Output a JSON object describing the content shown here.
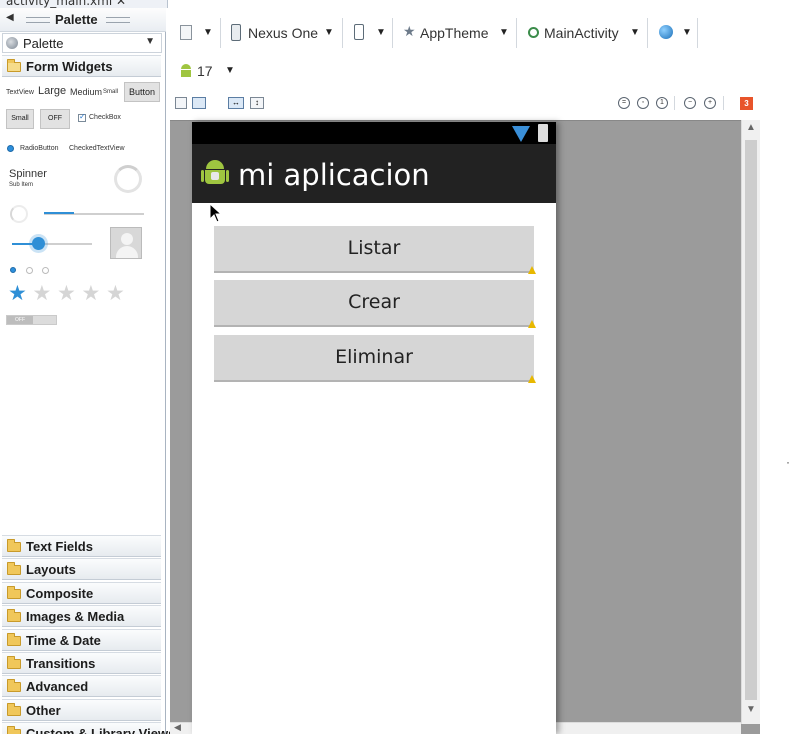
{
  "editor_tab": {
    "label": "activity_main.xml"
  },
  "palette": {
    "header_title": "Palette",
    "combo_label": "Palette",
    "open_category": "Form Widgets",
    "widgets": {
      "textview": "TextView",
      "large": "Large",
      "medium": "Medium",
      "small": "Small",
      "button": "Button",
      "small_button": "Small",
      "toggle_off": "OFF",
      "checkbox": "CheckBox",
      "radiobutton": "RadioButton",
      "checked_textview": "CheckedTextView",
      "spinner": "Spinner",
      "sub_item": "Sub Item",
      "switch_off": "OFF"
    },
    "rating": {
      "filled": 1,
      "total": 5
    },
    "categories": [
      "Text Fields",
      "Layouts",
      "Composite",
      "Images & Media",
      "Time & Date",
      "Transitions",
      "Advanced",
      "Other",
      "Custom & Library Views"
    ]
  },
  "toolbar": {
    "device": "Nexus One",
    "theme": "AppTheme",
    "activity": "MainActivity",
    "api_level": "17",
    "error_count": "3"
  },
  "app": {
    "title": "mi aplicacion",
    "buttons": [
      "Listar",
      "Crear",
      "Eliminar"
    ]
  },
  "colors": {
    "action_bar": "#222222",
    "accent": "#2f8fd6",
    "android_green": "#9fc540",
    "warning": "#e8b800",
    "error_badge": "#e8542a"
  }
}
